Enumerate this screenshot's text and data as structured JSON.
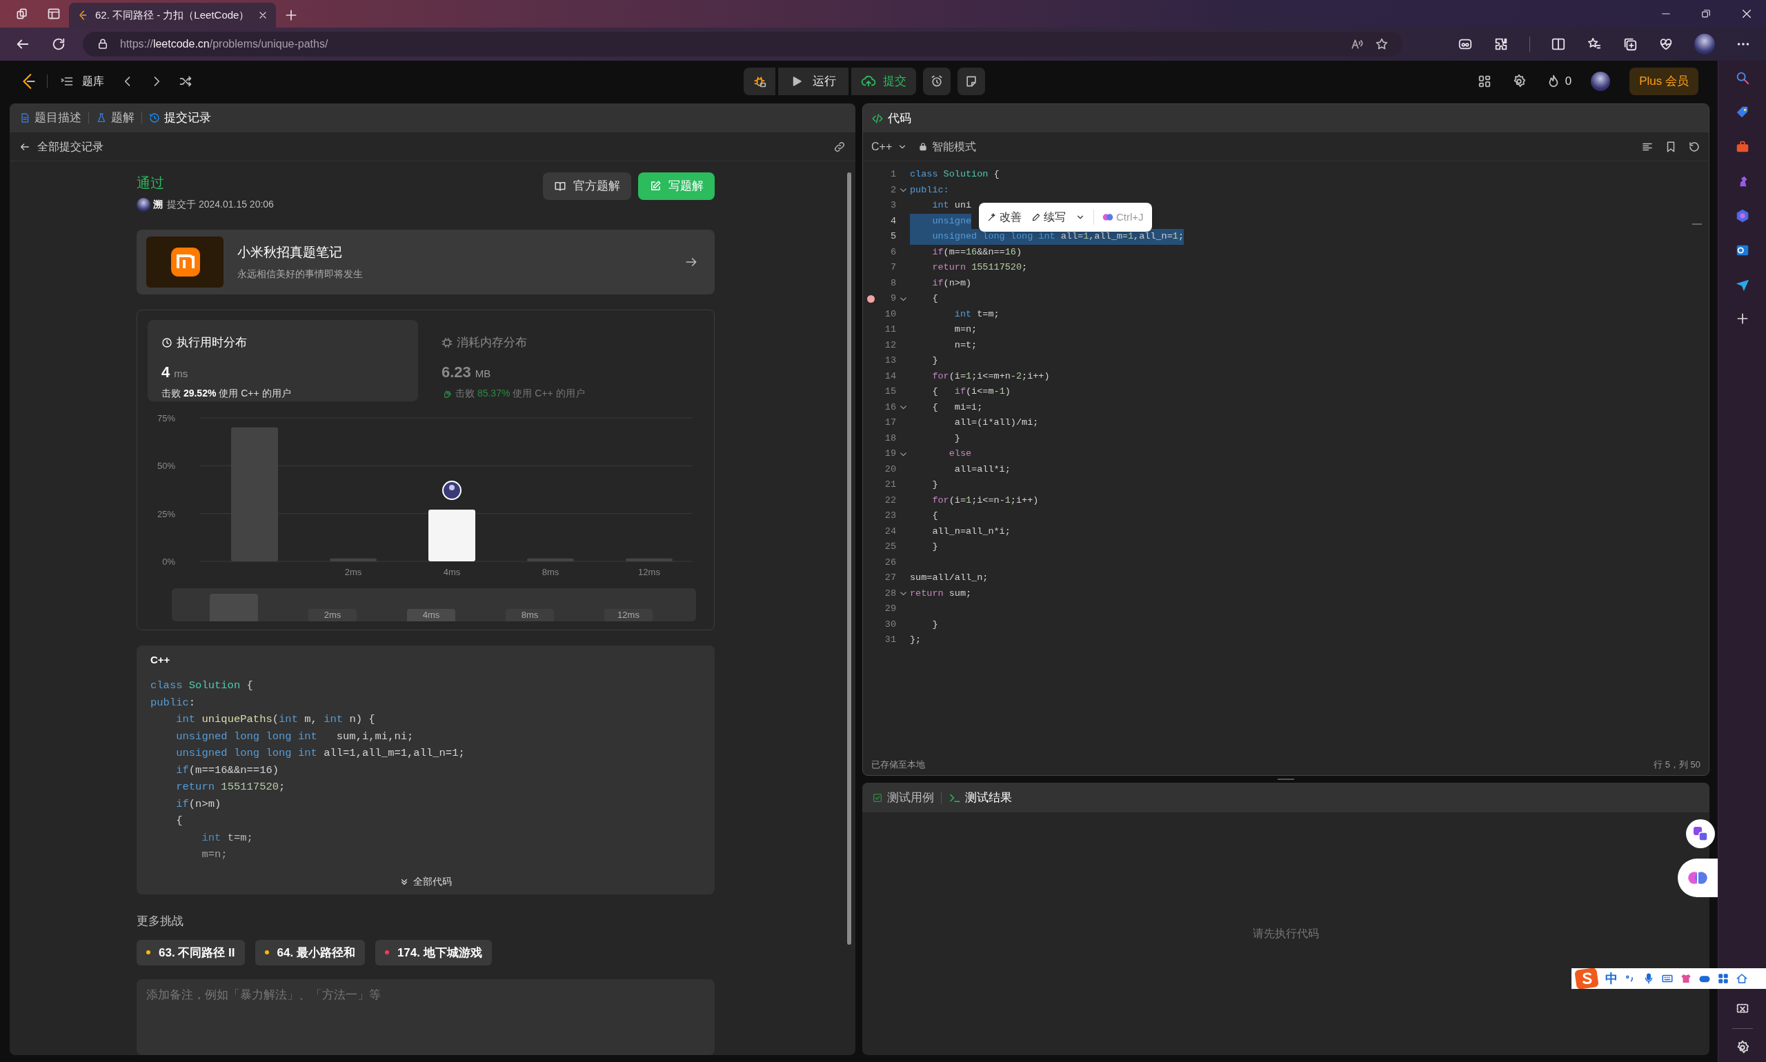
{
  "browser": {
    "tab_title": "62. 不同路径 - 力扣（LeetCode）",
    "url": {
      "scheme": "https://",
      "host": "leetcode.cn",
      "path": "/problems/unique-paths/"
    }
  },
  "nav": {
    "problem_list": "题库",
    "run": "运行",
    "submit": "提交",
    "streak": "0",
    "plus": "Plus 会员"
  },
  "left_tabs": [
    {
      "label": "题目描述",
      "kind": "doc",
      "selected": false
    },
    {
      "label": "题解",
      "kind": "flask",
      "selected": false
    },
    {
      "label": "提交记录",
      "kind": "history",
      "selected": true
    }
  ],
  "back_link": "全部提交记录",
  "submission": {
    "status": "通过",
    "user": "溯",
    "submitted": "提交于 2024.01.15 20:06",
    "official_button": "官方题解",
    "write_button": "写题解"
  },
  "promo": {
    "title": "小米秋招真题笔记",
    "subtitle": "永远相信美好的事情即将发生"
  },
  "stats": [
    {
      "kind": "time",
      "title": "执行用时分布",
      "value": "4",
      "unit": "ms",
      "beat": "击败 **29.52%** 使用 C++ 的用户",
      "selected": true
    },
    {
      "kind": "memory",
      "title": "消耗内存分布",
      "value": "6.23",
      "unit": "MB",
      "beat": "击败 **85.37%** 使用 C++ 的用户",
      "selected": false
    }
  ],
  "runtime_chart": {
    "chart_data": {
      "type": "bar",
      "categories": [
        null,
        "2ms",
        "4ms",
        "8ms",
        "12ms"
      ],
      "values": [
        70,
        1.5,
        27,
        1.5,
        1.5
      ],
      "ylim": [
        0,
        75
      ],
      "yticks": [
        {
          "value": 0,
          "label": "0%"
        },
        {
          "value": 25,
          "label": "25%"
        },
        {
          "value": 50,
          "label": "50%"
        },
        {
          "value": 75,
          "label": "75%"
        }
      ]
    },
    "highlighted": [
      false,
      false,
      true,
      false,
      false
    ],
    "overview_labels": [
      "2ms",
      "4ms",
      "8ms",
      "12ms"
    ]
  },
  "code_preview": {
    "language": "C++",
    "expand": "全部代码",
    "lines": [
      [
        {
          "kind": "k",
          "text": "class "
        },
        {
          "kind": "t",
          "text": "Solution"
        },
        {
          "kind": "p",
          "text": " {"
        }
      ],
      [
        {
          "kind": "k",
          "text": "public"
        },
        {
          "kind": "p",
          "text": ":"
        }
      ],
      [
        {
          "kind": "k",
          "text": "    int "
        },
        {
          "kind": "f",
          "text": "uniquePaths"
        },
        {
          "kind": "p",
          "text": "("
        },
        {
          "kind": "k",
          "text": "int"
        },
        {
          "kind": "p",
          "text": " m, "
        },
        {
          "kind": "k",
          "text": "int"
        },
        {
          "kind": "p",
          "text": " n) {"
        }
      ],
      [
        {
          "kind": "k",
          "text": "    unsigned long long int"
        },
        {
          "kind": "p",
          "text": "   sum,i,mi,ni;"
        }
      ],
      [
        {
          "kind": "k",
          "text": "    unsigned long long int"
        },
        {
          "kind": "p",
          "text": " all=1,all_m=1,all_n=1;"
        }
      ],
      [
        {
          "kind": "k",
          "text": "    if"
        },
        {
          "kind": "p",
          "text": "(m==16&&n==16)"
        }
      ],
      [
        {
          "kind": "k",
          "text": "    return "
        },
        {
          "kind": "n",
          "text": "155117520"
        },
        {
          "kind": "p",
          "text": ";"
        }
      ],
      [
        {
          "kind": "k",
          "text": "    if"
        },
        {
          "kind": "p",
          "text": "(n>m)"
        }
      ],
      [
        {
          "kind": "p",
          "text": "    {"
        }
      ],
      [
        {
          "kind": "k",
          "text": "        int"
        },
        {
          "kind": "p",
          "text": " t=m;"
        }
      ],
      [
        {
          "kind": "p",
          "text": "        m=n;"
        }
      ]
    ]
  },
  "more": {
    "title": "更多挑战",
    "items": [
      {
        "label": "63. 不同路径 II",
        "color": "#ffb800"
      },
      {
        "label": "64. 最小路径和",
        "color": "#ffb800"
      },
      {
        "label": "174. 地下城游戏",
        "color": "#ff375f"
      }
    ]
  },
  "note": {
    "placeholder": "添加备注，例如「暴力解法」、「方法一」等"
  },
  "editor": {
    "title": "代码",
    "language": "C++",
    "mode": "智能模式",
    "status": "已存储至本地",
    "cursor": "行 5，列 50",
    "ai_popup": {
      "improve": "改善",
      "continue": "续写",
      "shortcut": "Ctrl+J"
    },
    "lines": [
      {
        "number": "1",
        "fold": false,
        "breakpoint": false,
        "selected": false,
        "code": [
          {
            "kind": "k",
            "text": "class "
          },
          {
            "kind": "t",
            "text": "Solution"
          },
          {
            "kind": "p",
            "text": " {"
          }
        ]
      },
      {
        "number": "2",
        "fold": true,
        "breakpoint": false,
        "selected": false,
        "code": [
          {
            "kind": "k",
            "text": "public:"
          }
        ]
      },
      {
        "number": "3",
        "fold": false,
        "breakpoint": false,
        "selected": false,
        "code": [
          {
            "kind": "k",
            "text": "    int"
          },
          {
            "kind": "p",
            "text": " uni"
          }
        ]
      },
      {
        "number": "4",
        "fold": false,
        "breakpoint": false,
        "selected": true,
        "code": [
          {
            "kind": "k",
            "text": "    unsigne"
          }
        ]
      },
      {
        "number": "5",
        "fold": false,
        "breakpoint": false,
        "selected": true,
        "code": [
          {
            "kind": "k",
            "text": "    unsigned long long int"
          },
          {
            "kind": "p",
            "text": " all="
          },
          {
            "kind": "n",
            "text": "1"
          },
          {
            "kind": "p",
            "text": ",all_m="
          },
          {
            "kind": "n",
            "text": "1"
          },
          {
            "kind": "p",
            "text": ",all_n="
          },
          {
            "kind": "n",
            "text": "1"
          },
          {
            "kind": "p",
            "text": ";"
          }
        ]
      },
      {
        "number": "6",
        "fold": false,
        "breakpoint": false,
        "selected": false,
        "code": [
          {
            "kind": "c",
            "text": "    if"
          },
          {
            "kind": "p",
            "text": "(m=="
          },
          {
            "kind": "n",
            "text": "16"
          },
          {
            "kind": "p",
            "text": "&&n=="
          },
          {
            "kind": "n",
            "text": "16"
          },
          {
            "kind": "p",
            "text": ")"
          }
        ]
      },
      {
        "number": "7",
        "fold": false,
        "breakpoint": false,
        "selected": false,
        "code": [
          {
            "kind": "c",
            "text": "    return "
          },
          {
            "kind": "n",
            "text": "155117520"
          },
          {
            "kind": "p",
            "text": ";"
          }
        ]
      },
      {
        "number": "8",
        "fold": false,
        "breakpoint": false,
        "selected": false,
        "code": [
          {
            "kind": "c",
            "text": "    if"
          },
          {
            "kind": "p",
            "text": "(n>m)"
          }
        ]
      },
      {
        "number": "9",
        "fold": true,
        "breakpoint": true,
        "selected": false,
        "code": [
          {
            "kind": "p",
            "text": "    {"
          }
        ]
      },
      {
        "number": "10",
        "fold": false,
        "breakpoint": false,
        "selected": false,
        "code": [
          {
            "kind": "k",
            "text": "        int"
          },
          {
            "kind": "p",
            "text": " t=m;"
          }
        ]
      },
      {
        "number": "11",
        "fold": false,
        "breakpoint": false,
        "selected": false,
        "code": [
          {
            "kind": "p",
            "text": "        m=n;"
          }
        ]
      },
      {
        "number": "12",
        "fold": false,
        "breakpoint": false,
        "selected": false,
        "code": [
          {
            "kind": "p",
            "text": "        n=t;"
          }
        ]
      },
      {
        "number": "13",
        "fold": false,
        "breakpoint": false,
        "selected": false,
        "code": [
          {
            "kind": "p",
            "text": "    }"
          }
        ]
      },
      {
        "number": "14",
        "fold": false,
        "breakpoint": false,
        "selected": false,
        "code": [
          {
            "kind": "c",
            "text": "    for"
          },
          {
            "kind": "p",
            "text": "(i="
          },
          {
            "kind": "n",
            "text": "1"
          },
          {
            "kind": "p",
            "text": ";i<=m+n-"
          },
          {
            "kind": "n",
            "text": "2"
          },
          {
            "kind": "p",
            "text": ";i++)"
          }
        ]
      },
      {
        "number": "15",
        "fold": false,
        "breakpoint": false,
        "selected": false,
        "code": [
          {
            "kind": "p",
            "text": "    {   "
          },
          {
            "kind": "c",
            "text": "if"
          },
          {
            "kind": "p",
            "text": "(i<=m-"
          },
          {
            "kind": "n",
            "text": "1"
          },
          {
            "kind": "p",
            "text": ")"
          }
        ]
      },
      {
        "number": "16",
        "fold": true,
        "breakpoint": false,
        "selected": false,
        "code": [
          {
            "kind": "p",
            "text": "    {   mi=i;"
          }
        ]
      },
      {
        "number": "17",
        "fold": false,
        "breakpoint": false,
        "selected": false,
        "code": [
          {
            "kind": "p",
            "text": "        all=(i*all)/mi;"
          }
        ]
      },
      {
        "number": "18",
        "fold": false,
        "breakpoint": false,
        "selected": false,
        "code": [
          {
            "kind": "p",
            "text": "        }"
          }
        ]
      },
      {
        "number": "19",
        "fold": true,
        "breakpoint": false,
        "selected": false,
        "code": [
          {
            "kind": "c",
            "text": "       else"
          }
        ]
      },
      {
        "number": "20",
        "fold": false,
        "breakpoint": false,
        "selected": false,
        "code": [
          {
            "kind": "p",
            "text": "        all=all*i;"
          }
        ]
      },
      {
        "number": "21",
        "fold": false,
        "breakpoint": false,
        "selected": false,
        "code": [
          {
            "kind": "p",
            "text": "    }"
          }
        ]
      },
      {
        "number": "22",
        "fold": false,
        "breakpoint": false,
        "selected": false,
        "code": [
          {
            "kind": "c",
            "text": "    for"
          },
          {
            "kind": "p",
            "text": "(i="
          },
          {
            "kind": "n",
            "text": "1"
          },
          {
            "kind": "p",
            "text": ";i<=n-"
          },
          {
            "kind": "n",
            "text": "1"
          },
          {
            "kind": "p",
            "text": ";i++)"
          }
        ]
      },
      {
        "number": "23",
        "fold": false,
        "breakpoint": false,
        "selected": false,
        "code": [
          {
            "kind": "p",
            "text": "    {"
          }
        ]
      },
      {
        "number": "24",
        "fold": false,
        "breakpoint": false,
        "selected": false,
        "code": [
          {
            "kind": "p",
            "text": "    all_n=all_n*i;"
          }
        ]
      },
      {
        "number": "25",
        "fold": false,
        "breakpoint": false,
        "selected": false,
        "code": [
          {
            "kind": "p",
            "text": "    }"
          }
        ]
      },
      {
        "number": "26",
        "fold": false,
        "breakpoint": false,
        "selected": false
      },
      {
        "number": "27",
        "fold": false,
        "breakpoint": false,
        "selected": false,
        "code": [
          {
            "kind": "p",
            "text": "sum=all/all_n;"
          }
        ]
      },
      {
        "number": "28",
        "fold": true,
        "breakpoint": false,
        "selected": false,
        "code": [
          {
            "kind": "c",
            "text": "return"
          },
          {
            "kind": "p",
            "text": " sum;"
          }
        ]
      },
      {
        "number": "29",
        "fold": false,
        "breakpoint": false,
        "selected": false
      },
      {
        "number": "30",
        "fold": false,
        "breakpoint": false,
        "selected": false,
        "code": [
          {
            "kind": "p",
            "text": "    }"
          }
        ]
      },
      {
        "number": "31",
        "fold": false,
        "breakpoint": false,
        "selected": false,
        "code": [
          {
            "kind": "p",
            "text": "};"
          }
        ]
      }
    ]
  },
  "test_tabs": [
    {
      "label": "测试用例",
      "kind": "cases",
      "selected": false
    },
    {
      "label": "测试结果",
      "kind": "result",
      "selected": true
    }
  ],
  "test_empty": "请先执行代码",
  "ime": {
    "mode": "中"
  }
}
